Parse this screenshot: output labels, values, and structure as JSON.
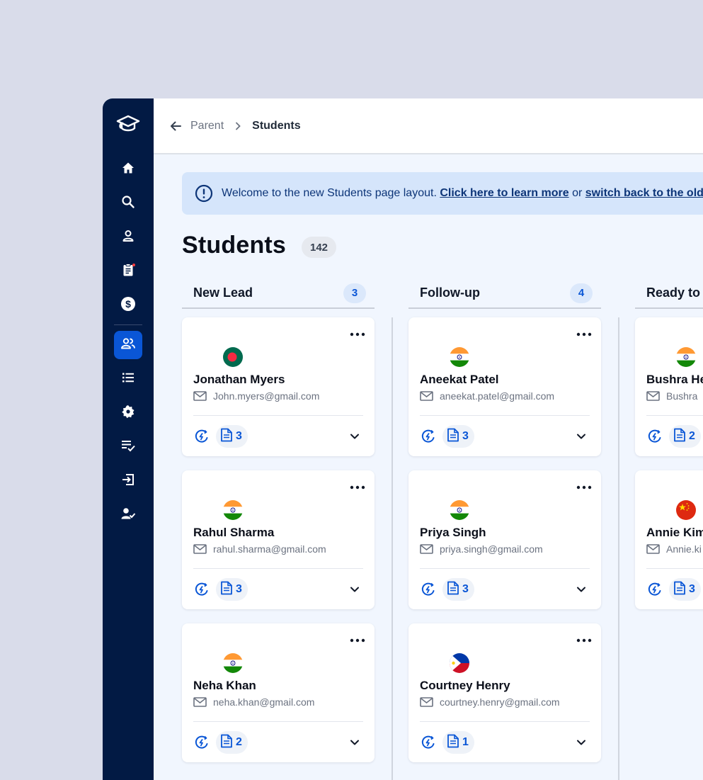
{
  "breadcrumb": {
    "parent": "Parent",
    "current": "Students"
  },
  "banner": {
    "text": "Welcome to the new Students page layout.",
    "link1": "Click here to learn more",
    "connector": "or",
    "link2": "switch back to the old layout"
  },
  "page": {
    "title": "Students",
    "count": "142"
  },
  "sidebar": {
    "items": [
      "home-icon",
      "search-icon",
      "user-icon",
      "clipboard-icon",
      "dollar-icon",
      "students-icon",
      "list-icon",
      "gear-icon",
      "checklist-icon",
      "login-icon",
      "user-check-icon"
    ],
    "active": "students-icon"
  },
  "colors": {
    "navy": "#021a44",
    "accent": "#0a56d6",
    "banner_bg": "#d5e5fb"
  },
  "columns": [
    {
      "title": "New Lead",
      "count": "3",
      "cards": [
        {
          "name": "Jonathan Myers",
          "email": "John.myers@gmail.com",
          "flag": "bangladesh",
          "docs": "3"
        },
        {
          "name": "Rahul Sharma",
          "email": "rahul.sharma@gmail.com",
          "flag": "india",
          "docs": "3"
        },
        {
          "name": "Neha Khan",
          "email": "neha.khan@gmail.com",
          "flag": "india",
          "docs": "2"
        }
      ]
    },
    {
      "title": "Follow-up",
      "count": "4",
      "cards": [
        {
          "name": "Aneekat Patel",
          "email": "aneekat.patel@gmail.com",
          "flag": "india",
          "docs": "3"
        },
        {
          "name": "Priya Singh",
          "email": "priya.singh@gmail.com",
          "flag": "india",
          "docs": "3"
        },
        {
          "name": "Courtney Henry",
          "email": "courtney.henry@gmail.com",
          "flag": "philippines",
          "docs": "1"
        }
      ]
    },
    {
      "title": "Ready to",
      "cards": [
        {
          "name": "Bushra He",
          "email": "Bushra",
          "flag": "india",
          "docs": "2"
        },
        {
          "name": "Annie Kim",
          "email": "Annie.ki",
          "flag": "china",
          "docs": "3"
        }
      ]
    }
  ]
}
